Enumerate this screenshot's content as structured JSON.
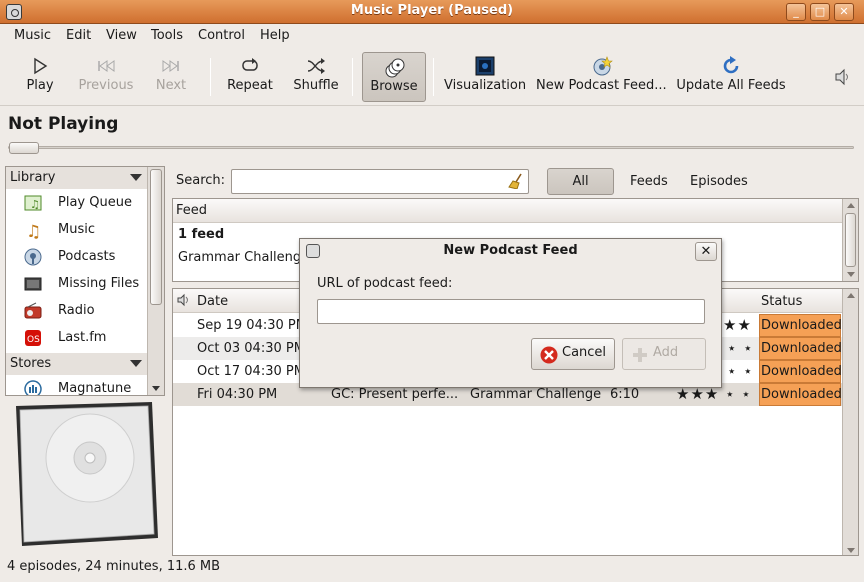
{
  "window": {
    "title": "Music Player (Paused)"
  },
  "menu": [
    "Music",
    "Edit",
    "View",
    "Tools",
    "Control",
    "Help"
  ],
  "toolbar": {
    "play": "Play",
    "previous": "Previous",
    "next": "Next",
    "repeat": "Repeat",
    "shuffle": "Shuffle",
    "browse": "Browse",
    "visualization": "Visualization",
    "new_podcast": "New Podcast Feed...",
    "update_all": "Update All Feeds"
  },
  "now_playing": "Not Playing",
  "sidebar": {
    "library_header": "Library",
    "library": [
      "Play Queue",
      "Music",
      "Podcasts",
      "Missing Files",
      "Radio",
      "Last.fm"
    ],
    "stores_header": "Stores",
    "stores": [
      "Magnatune"
    ]
  },
  "search": {
    "label": "Search:",
    "value": ""
  },
  "filters": {
    "all": "All",
    "feeds": "Feeds",
    "episodes": "Episodes"
  },
  "feeds": {
    "column": "Feed",
    "summary": "1 feed",
    "items": [
      "Grammar Challeng"
    ]
  },
  "episodes": {
    "columns": {
      "date": "Date",
      "status": "Status"
    },
    "rows": [
      {
        "date": "Sep 19 04:30 PM",
        "title": "",
        "feed": "",
        "duration": "",
        "rating": "★★",
        "status": "Downloaded"
      },
      {
        "date": "Oct 03 04:30 PM",
        "title": "",
        "feed": "",
        "duration": "",
        "rating": "⋆ ⋆",
        "status": "Downloaded"
      },
      {
        "date": "Oct 17 04:30 PM",
        "title": "",
        "feed": "",
        "duration": "",
        "rating": "⋆ ⋆",
        "status": "Downloaded"
      },
      {
        "date": "Fri 04:30 PM",
        "title": "GC: Present perfe...",
        "feed": "Grammar Challenge",
        "duration": "6:10",
        "rating": "★★★ ⋆ ⋆",
        "status": "Downloaded"
      }
    ]
  },
  "dialog": {
    "title": "New Podcast Feed",
    "label": "URL of podcast feed:",
    "url_value": "",
    "cancel": "Cancel",
    "add": "Add"
  },
  "statusbar": "4 episodes, 24 minutes, 11.6 MB",
  "colors": {
    "titlebar": "#d97a3a",
    "downloaded": "#f5a055"
  }
}
